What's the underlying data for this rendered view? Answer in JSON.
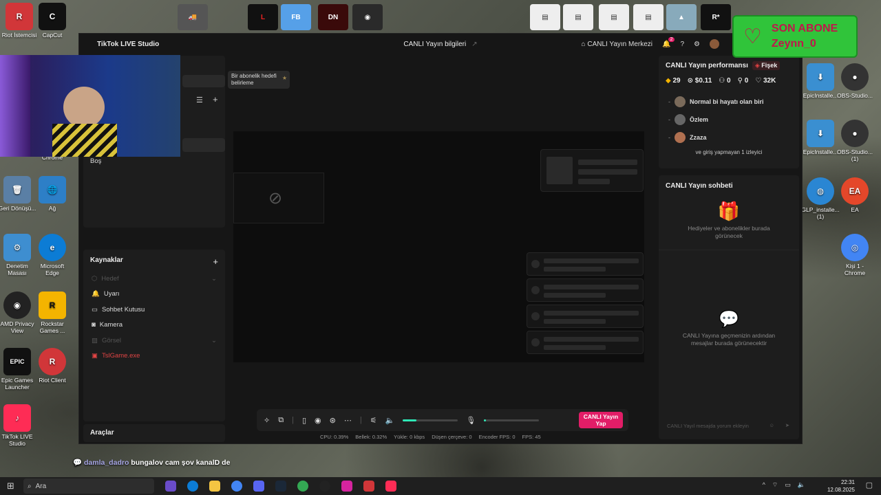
{
  "desktop": {
    "left_icons": [
      {
        "label": "Riot İstemcisi",
        "color": "#d13639",
        "glyph": "R"
      },
      {
        "label": "CapCut",
        "color": "#111111",
        "glyph": "C"
      },
      {
        "label": "Geri Dönüşü...",
        "color": "#4a7fb5",
        "glyph": "🗑"
      },
      {
        "label": "Ağ",
        "color": "#2d7fc7",
        "glyph": "🌐"
      },
      {
        "label": "Denetim Masası",
        "color": "#3e8ed0",
        "glyph": "⚙"
      },
      {
        "label": "Microsoft Edge",
        "color": "#0c7cd5",
        "glyph": "e"
      },
      {
        "label": "AMD Privacy View",
        "color": "#222222",
        "glyph": "◉"
      },
      {
        "label": "Rockstar Games ...",
        "color": "#f4b400",
        "glyph": "R"
      },
      {
        "label": "Epic Games Launcher",
        "color": "#111111",
        "glyph": "EPIC"
      },
      {
        "label": "Riot Client",
        "color": "#d13639",
        "glyph": "R"
      },
      {
        "label": "TikTok LIVE Studio",
        "color": "#fe2c55",
        "glyph": "♪"
      }
    ],
    "right_icons": [
      {
        "label": "EpicInstalle...",
        "color": "#3a8fd1",
        "glyph": "⬇"
      },
      {
        "label": "OBS-Studio...",
        "color": "#333333",
        "glyph": "●"
      },
      {
        "label": "EpicInstalle...",
        "color": "#3a8fd1",
        "glyph": "⬇"
      },
      {
        "label": "OBS-Studio... (1)",
        "color": "#333333",
        "glyph": "●"
      },
      {
        "label": "GLP_installe... (1)",
        "color": "#2a86d3",
        "glyph": "◍"
      },
      {
        "label": "EA",
        "color": "#e4472a",
        "glyph": "EA"
      },
      {
        "label": "Kişi 1 - Chrome",
        "color": "#4285f4",
        "glyph": "◎"
      }
    ],
    "chrome_label": "Chrome"
  },
  "window": {
    "title_app": "TikTok LIVE Studio",
    "title_center": "CANLI Yayın bilgileri",
    "live_center": "CANLI Yayın Merkezi",
    "notif_count": "2"
  },
  "left_panel": {
    "goal_bubble": "Bir abonelik hedefi belirleme",
    "empty_label": "Boş"
  },
  "sources": {
    "title": "Kaynaklar",
    "items": [
      {
        "label": "Hedef",
        "state": "dim"
      },
      {
        "label": "Uyarı",
        "state": "normal"
      },
      {
        "label": "Sohbet Kutusu",
        "state": "normal"
      },
      {
        "label": "Kamera",
        "state": "normal"
      },
      {
        "label": "Görsel",
        "state": "dim"
      },
      {
        "label": "TslGame.exe",
        "state": "red"
      }
    ],
    "tools_title": "Araçlar"
  },
  "controls": {
    "go_live": "CANLI Yayın Yap",
    "audio_level": 0.25,
    "mic_level": 0.02
  },
  "stats": {
    "cpu": "CPU:  0.39%",
    "memory": "Bellek:  0.32%",
    "upload": "Yükle:  0 kbps",
    "dropped": "Düşen çerçeve:  0",
    "encoder_fps": "Encoder FPS:  0",
    "fps": "FPS:  45"
  },
  "performance": {
    "title": "CANLI Yayın performansı",
    "badge": "Fişek",
    "metrics": [
      {
        "icon": "💎",
        "value": "29"
      },
      {
        "icon": "$",
        "value": "$0.11"
      },
      {
        "icon": "👥",
        "value": "0"
      },
      {
        "icon": "➕",
        "value": "0"
      },
      {
        "icon": "♡",
        "value": "32K"
      }
    ],
    "viewers": [
      "Normal bi hayatı olan biri",
      "Özlem",
      "Zzaza"
    ],
    "anonymous": "ve giriş yapmayan 1 izleyici"
  },
  "chat": {
    "title": "CANLI Yayın sohbeti",
    "gifts_empty": "Hediyeler ve abonelikler burada görünecek",
    "messages_empty": "CANLI Yayına geçmenizin ardından mesajlar burada görünecektir",
    "input_placeholder": "CANLI Yayıl mesajda yorum ekleyin"
  },
  "overlay": {
    "son_abone_title": "SON ABONE",
    "son_abone_name": "Zeynn_0",
    "chat_user": "damla_dadro",
    "chat_text": "bungalov cam şov kanalD de"
  },
  "taskbar": {
    "search_placeholder": "Ara",
    "time": "22:31",
    "date": "12.08.2025"
  }
}
